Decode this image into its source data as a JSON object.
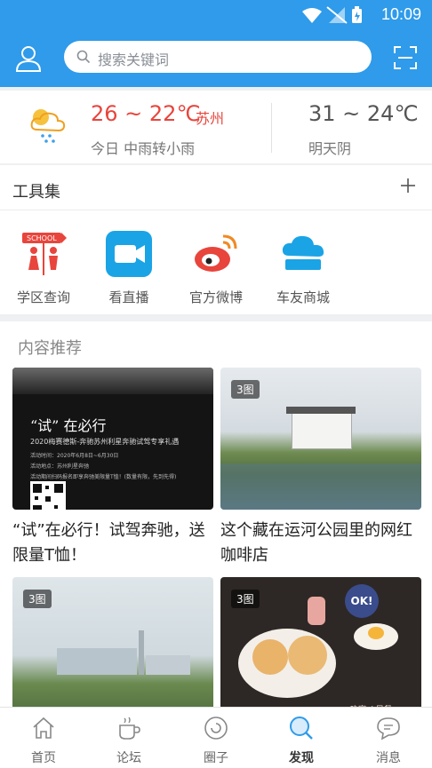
{
  "status": {
    "time": "10:09"
  },
  "search": {
    "placeholder": "搜索关键词"
  },
  "weather": {
    "today_temp": "26 ~ 22℃",
    "city": "苏州",
    "today_desc": "今日 中雨转小雨",
    "tomorrow_temp": "31 ~ 24℃",
    "tomorrow_desc": "明天阴"
  },
  "tools": {
    "title": "工具集",
    "items": [
      {
        "label": "学区查询",
        "icon": "school-sign-icon"
      },
      {
        "label": "看直播",
        "icon": "video-camera-icon"
      },
      {
        "label": "官方微博",
        "icon": "weibo-icon"
      },
      {
        "label": "车友商城",
        "icon": "cloud-mall-icon"
      }
    ]
  },
  "content": {
    "title": "内容推荐",
    "posts": [
      {
        "title": "“试”在必行！试驾奔驰，送限量T恤！",
        "thumb_heading": "“试” 在必行",
        "thumb_sub": "2020梅赛德斯-奔驰苏州利星奔驰试驾专享礼遇",
        "thumb_line1": "活动时间：2020年6月8日~6月30日",
        "thumb_line2": "活动地点：苏州利星奔驰",
        "thumb_line3": "活动期间扫码报名即享奔驰美限量T恤！(数量有限，先到先得)"
      },
      {
        "title": "这个藏在运河公园里的网红咖啡店",
        "badge": "3图"
      },
      {
        "title": "",
        "badge": "3图"
      },
      {
        "title": "",
        "badge": "3图",
        "stamp": "OK!",
        "caption": "玖宴ok早餐"
      }
    ]
  },
  "tabbar": {
    "items": [
      {
        "label": "首页",
        "icon": "home-icon"
      },
      {
        "label": "论坛",
        "icon": "coffee-cup-icon"
      },
      {
        "label": "圈子",
        "icon": "circle-refresh-icon"
      },
      {
        "label": "发现",
        "icon": "discover-search-icon"
      },
      {
        "label": "消息",
        "icon": "message-bubble-icon"
      }
    ],
    "active": "发现"
  }
}
